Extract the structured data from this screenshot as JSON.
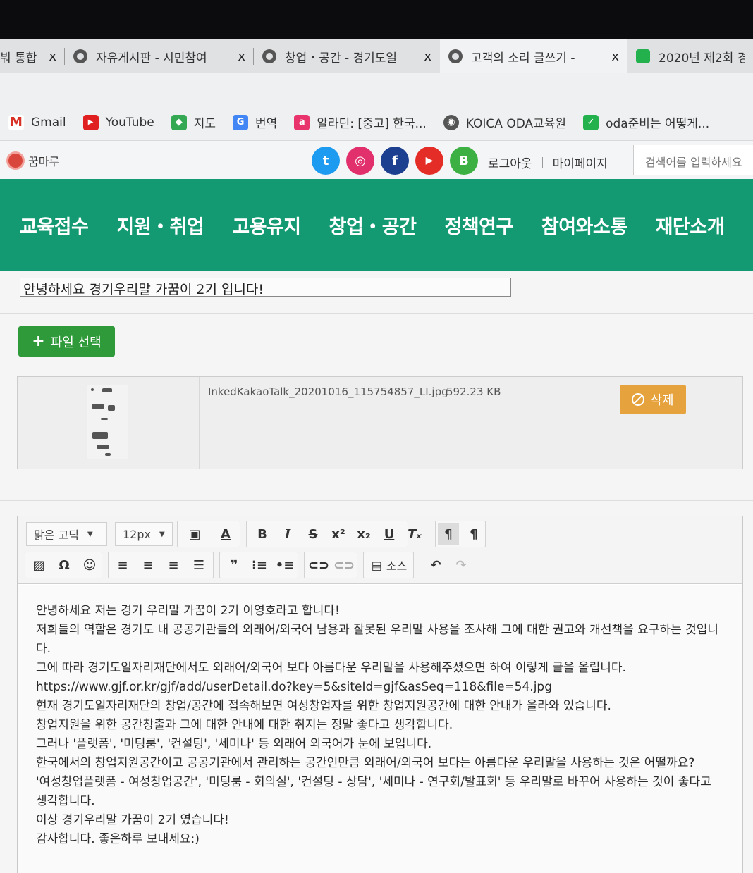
{
  "browser": {
    "tabs": [
      {
        "title": "붜 통합",
        "active": false
      },
      {
        "title": "자유게시판 - 시민참여",
        "active": false
      },
      {
        "title": "창업・공간 - 경기도일",
        "active": false
      },
      {
        "title": "고객의 소리 글쓰기 -",
        "active": true
      },
      {
        "title": "2020년 제2회 경",
        "active": false
      }
    ],
    "close_glyph": "x",
    "bookmarks": [
      {
        "label": "Gmail",
        "icon": "gmail-icon",
        "color": "#d93025"
      },
      {
        "label": "YouTube",
        "icon": "youtube-icon",
        "color": "#e02020"
      },
      {
        "label": "지도",
        "icon": "maps-icon",
        "color": "#34a853"
      },
      {
        "label": "번역",
        "icon": "translate-icon",
        "color": "#4285f4"
      },
      {
        "label": "알라딘: [중고] 한국...",
        "icon": "aladin-icon",
        "color": "#e8336d"
      },
      {
        "label": "KOICA ODA교육원",
        "icon": "globe-icon",
        "color": "#555555"
      },
      {
        "label": "oda준비는 어떻게...",
        "icon": "bookmark-green-icon",
        "color": "#22b14c"
      }
    ]
  },
  "site": {
    "logo": "꿈마루",
    "social": [
      {
        "name": "twitter-icon",
        "glyph": "t",
        "color": "#1d9bf0"
      },
      {
        "name": "instagram-icon",
        "glyph": "◎",
        "color": "#e1306c"
      },
      {
        "name": "facebook-icon",
        "glyph": "f",
        "color": "#1c3f8f"
      },
      {
        "name": "youtube-social-icon",
        "glyph": "▶",
        "color": "#e52d27"
      },
      {
        "name": "blog-icon",
        "glyph": "B",
        "color": "#3cb043"
      }
    ],
    "logout": "로그아웃",
    "mypage": "마이페이지",
    "search_placeholder": "검색어를 입력하세요",
    "menu": [
      "교육접수",
      "지원・취업",
      "고용유지",
      "창업・공간",
      "정책연구",
      "참여와소통",
      "재단소개"
    ],
    "brand_color": "#139a72"
  },
  "form": {
    "subject": "안녕하세요 경기우리말 가꿈이 2기 입니다!",
    "file_button": "파일 선택",
    "file": {
      "name": "InkedKakaoTalk_20201016_115754857_LI.jpg",
      "size": "592.23 KB",
      "delete_label": "삭제"
    }
  },
  "editor": {
    "font_family": "맑은 고딕",
    "font_size": "12px",
    "source_label": "소스",
    "paragraphs": [
      "안녕하세요 저는 경기 우리말 가꿈이 2기 이영호라고 합니다!",
      "저희들의 역할은 경기도 내 공공기관들의 외래어/외국어 남용과 잘못된 우리말 사용을 조사해 그에 대한 권고와 개선책을 요구하는 것입니다.",
      "그에 따라 경기도일자리재단에서도 외래어/외국어 보다 아름다운 우리말을 사용해주셨으면 하여 이렇게 글을 올립니다.",
      "https://www.gjf.or.kr/gjf/add/userDetail.do?key=5&siteId=gjf&asSeq=118&file=54.jpg",
      "현재 경기도일자리재단의 창업/공간에 접속해보면 여성창업자를 위한 창업지원공간에 대한 안내가 올라와 있습니다.",
      "창업지원을 위한 공간창출과 그에 대한 안내에 대한 취지는 정말 좋다고 생각합니다.",
      "그러나 '플랫폼', '미팅룸', '컨설팅', '세미나' 등 외래어 외국어가 눈에 보입니다.",
      "한국에서의 창업지원공간이고 공공기관에서 관리하는 공간인만큼 외래어/외국어 보다는 아름다운 우리말을 사용하는 것은 어떨까요?",
      "'여성창업플랫폼 - 여성창업공간', '미팅룸 - 회의실', '컨설팅 - 상담', '세미나 - 연구회/발표회' 등 우리말로 바꾸어 사용하는 것이 좋다고 생각합니다.",
      "이상 경기우리말 가꿈이 2기 였습니다!",
      "감사합니다. 좋은하루 보내세요:)"
    ]
  }
}
